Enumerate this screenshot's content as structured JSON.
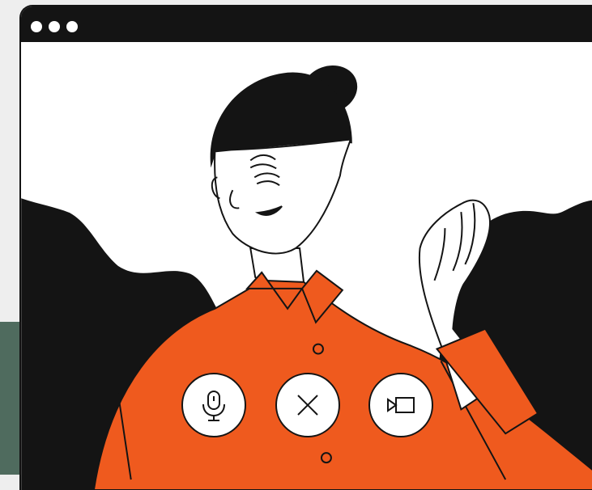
{
  "window": {
    "title_dots": [
      "dot",
      "dot",
      "dot"
    ]
  },
  "controls": {
    "mic_icon": "microphone-icon",
    "end_icon": "close-icon",
    "video_icon": "video-camera-icon"
  },
  "colors": {
    "shirt": "#ef5a1e",
    "ink": "#141414",
    "window_bg": "#ffffff",
    "page_bg": "#eeeeee",
    "accent_green": "#4f6b5e"
  }
}
